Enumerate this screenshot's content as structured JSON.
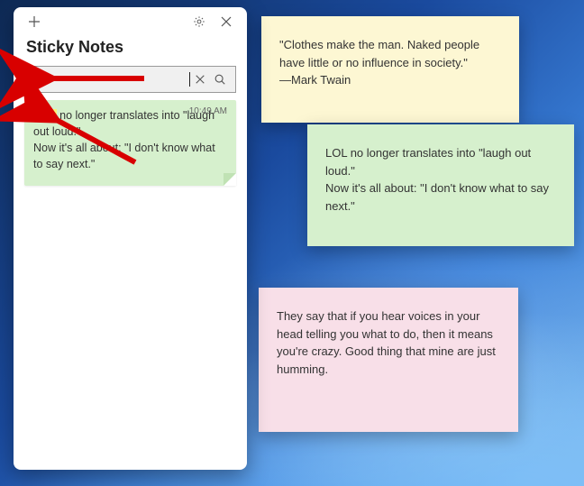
{
  "app": {
    "title": "Sticky Notes"
  },
  "search": {
    "value": "lol",
    "placeholder": "Search"
  },
  "list": {
    "items": [
      {
        "time": "10:49 AM",
        "highlight": "LOL",
        "text_after_highlight": " no longer translates into \"laugh out loud.\"",
        "line2": "Now it's all about: \"I don't know what to say next.\""
      }
    ]
  },
  "notes": {
    "yellow": {
      "line1": "\"Clothes make the man. Naked people have little or no influence in society.\"",
      "line2": "—Mark Twain"
    },
    "green": {
      "line1": "LOL no longer translates into \"laugh out loud.\"",
      "line2": "Now it's all about: \"I don't know what to say next.\""
    },
    "pink": {
      "text": "They say that if you hear voices in your head telling you what to do, then it means you're crazy. Good thing that mine are just humming."
    }
  }
}
